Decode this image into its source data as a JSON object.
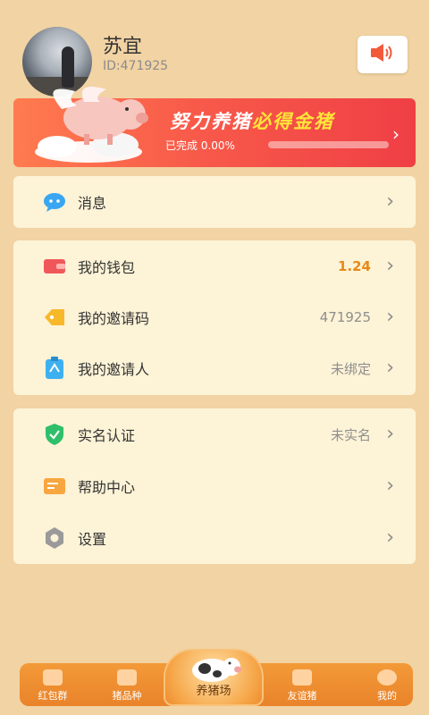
{
  "profile": {
    "name": "苏宜",
    "id_text": "ID:471925"
  },
  "banner": {
    "title_part1": "努力养猪",
    "title_part2": "必得金猪",
    "progress_text": "已完成 0.00%",
    "progress": 0.0
  },
  "menu": {
    "message": {
      "label": "消息"
    },
    "wallet": {
      "label": "我的钱包",
      "value": "1.24"
    },
    "invite_code": {
      "label": "我的邀请码",
      "value": "471925"
    },
    "inviter": {
      "label": "我的邀请人",
      "value": "未绑定"
    },
    "realname": {
      "label": "实名认证",
      "value": "未实名"
    },
    "help": {
      "label": "帮助中心"
    },
    "settings": {
      "label": "设置"
    }
  },
  "tabs": {
    "red_packet": "红包群",
    "pig_breed": "猪品种",
    "farm": "养猪场",
    "friend_pig": "友谊猪",
    "mine": "我的"
  },
  "colors": {
    "background": "#f2d3a3",
    "card": "#fdf3d7",
    "accent_orange": "#e88a17",
    "banner_red": "#ef3f45",
    "banner_gold": "#ffe43a"
  }
}
